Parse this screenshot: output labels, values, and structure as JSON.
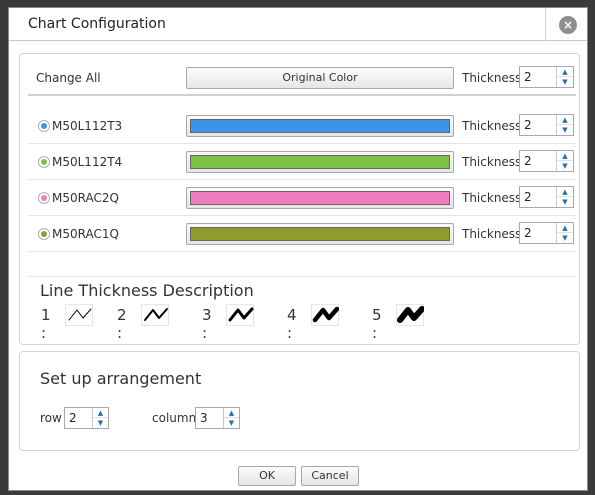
{
  "dialog": {
    "title": "Chart Configuration",
    "close_label": "×"
  },
  "change_all": {
    "label": "Change All",
    "button_label": "Original Color",
    "thickness_label": "Thickness",
    "thickness_value": "2"
  },
  "series": [
    {
      "name": "M50L112T3",
      "color": "#3a95e8",
      "thickness_label": "Thickness",
      "thickness_value": "2"
    },
    {
      "name": "M50L112T4",
      "color": "#7dc142",
      "thickness_label": "Thickness",
      "thickness_value": "2"
    },
    {
      "name": "M50RAC2Q",
      "color": "#f07cc0",
      "thickness_label": "Thickness",
      "thickness_value": "2"
    },
    {
      "name": "M50RAC1Q",
      "color": "#8f9b2c",
      "thickness_label": "Thickness",
      "thickness_value": "2"
    }
  ],
  "thickness_description": {
    "title": "Line Thickness Description",
    "items": [
      {
        "label": "1 :",
        "stroke": 1
      },
      {
        "label": "2 :",
        "stroke": 2
      },
      {
        "label": "3 :",
        "stroke": 3
      },
      {
        "label": "4 :",
        "stroke": 4.5
      },
      {
        "label": "5 :",
        "stroke": 6
      }
    ]
  },
  "arrangement": {
    "title": "Set up arrangement",
    "row_label": "row",
    "row_value": "2",
    "column_label": "column",
    "column_value": "3"
  },
  "buttons": {
    "ok": "OK",
    "cancel": "Cancel"
  },
  "spinner": {
    "up": "▲",
    "down": "▼"
  }
}
